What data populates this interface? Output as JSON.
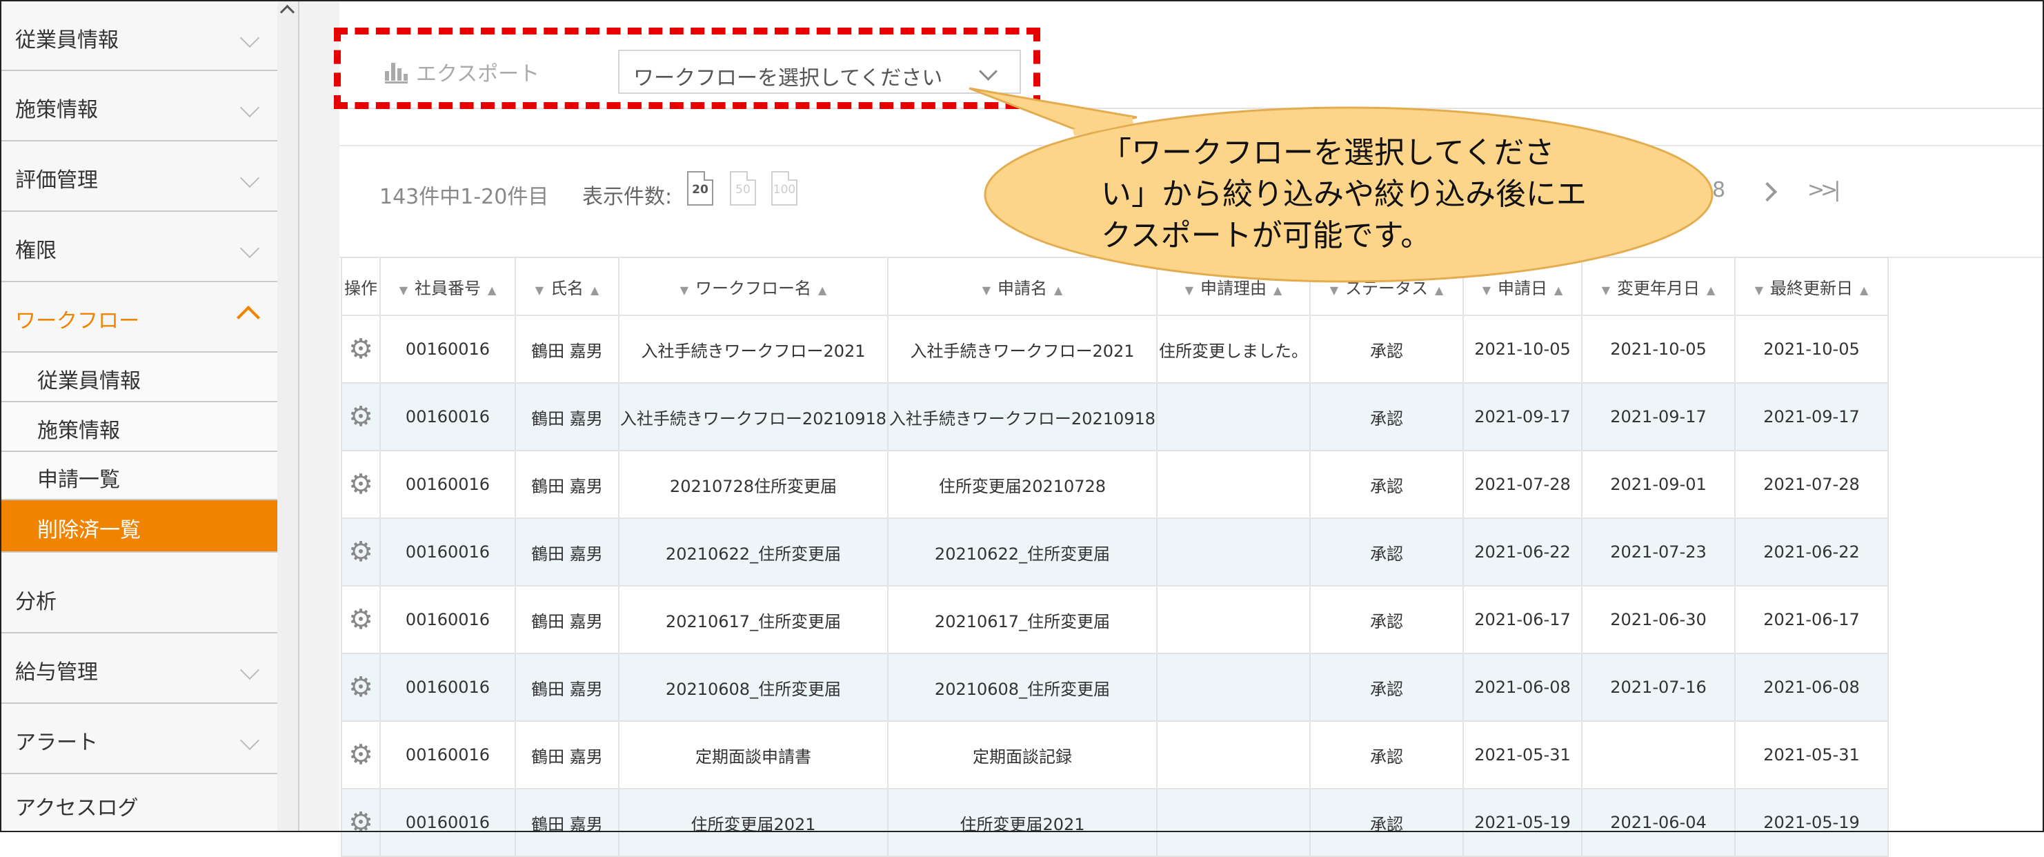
{
  "sidebar": {
    "items": [
      {
        "label": "従業員情報"
      },
      {
        "label": "施策情報"
      },
      {
        "label": "評価管理"
      },
      {
        "label": "権限"
      },
      {
        "label": "ワークフロー"
      },
      {
        "label": "分析"
      },
      {
        "label": "給与管理"
      },
      {
        "label": "アラート"
      },
      {
        "label": "アクセスログ"
      }
    ],
    "subitems": [
      {
        "label": "従業員情報"
      },
      {
        "label": "施策情報"
      },
      {
        "label": "申請一覧"
      },
      {
        "label": "削除済一覧"
      }
    ],
    "accent_color": "#f08300"
  },
  "toolbar": {
    "export_label": "エクスポート",
    "export_icon": "bar-chart-icon",
    "workflow_select": {
      "selected": "ワークフローを選択してください"
    }
  },
  "pager": {
    "record_count": "143件中1-20件目",
    "per_page_label": "表示件数:",
    "per_page_options": [
      "20",
      "50",
      "100"
    ],
    "visible_page": "8"
  },
  "table": {
    "columns": [
      "操作",
      "社員番号",
      "氏名",
      "ワークフロー名",
      "申請名",
      "申請理由",
      "ステータス",
      "申請日",
      "変更年月日",
      "最終更新日"
    ],
    "rows": [
      [
        "",
        "00160016",
        "鶴田 嘉男",
        "入社手続きワークフロー2021",
        "入社手続きワークフロー2021",
        "住所変更しました。",
        "承認",
        "2021-10-05",
        "2021-10-05",
        "2021-10-05"
      ],
      [
        "",
        "00160016",
        "鶴田 嘉男",
        "入社手続きワークフロー20210918",
        "入社手続きワークフロー20210918",
        "",
        "承認",
        "2021-09-17",
        "2021-09-17",
        "2021-09-17"
      ],
      [
        "",
        "00160016",
        "鶴田 嘉男",
        "20210728住所変更届",
        "住所変更届20210728",
        "",
        "承認",
        "2021-07-28",
        "2021-09-01",
        "2021-07-28"
      ],
      [
        "",
        "00160016",
        "鶴田 嘉男",
        "20210622_住所変更届",
        "20210622_住所変更届",
        "",
        "承認",
        "2021-06-22",
        "2021-07-23",
        "2021-06-22"
      ],
      [
        "",
        "00160016",
        "鶴田 嘉男",
        "20210617_住所変更届",
        "20210617_住所変更届",
        "",
        "承認",
        "2021-06-17",
        "2021-06-30",
        "2021-06-17"
      ],
      [
        "",
        "00160016",
        "鶴田 嘉男",
        "20210608_住所変更届",
        "20210608_住所変更届",
        "",
        "承認",
        "2021-06-08",
        "2021-07-16",
        "2021-06-08"
      ],
      [
        "",
        "00160016",
        "鶴田 嘉男",
        "定期面談申請書",
        "定期面談記録",
        "",
        "承認",
        "2021-05-31",
        "",
        "2021-05-31"
      ],
      [
        "",
        "00160016",
        "鶴田 嘉男",
        "住所変更届2021",
        "住所変更届2021",
        "",
        "承認",
        "2021-05-19",
        "2021-06-04",
        "2021-05-19"
      ]
    ]
  },
  "callout": {
    "text": "「ワークフローを選択してください」から絞り込みや絞り込み後にエクスポートが可能です。",
    "fill_color": "#fdd58a",
    "highlight_color": "#e60000"
  }
}
